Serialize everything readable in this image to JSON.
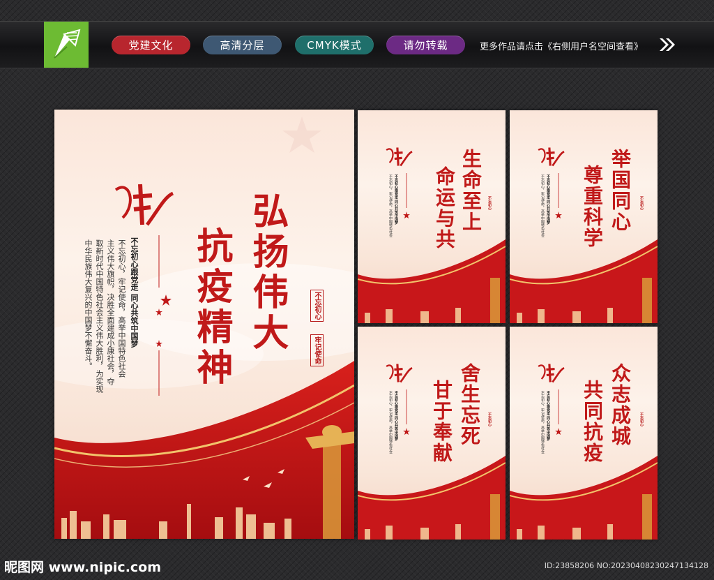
{
  "header": {
    "tags": [
      {
        "label": "党建文化",
        "color": "#b8262e"
      },
      {
        "label": "高清分层",
        "color": "#3e5873"
      },
      {
        "label": "CMYK模式",
        "color": "#1f6f6b"
      },
      {
        "label": "请勿转载",
        "color": "#6c2a84"
      }
    ],
    "more_text": "更多作品请点击《右侧用户名空间查看》",
    "logo_color": "#6dbb33"
  },
  "main_poster": {
    "title_col1": "弘扬伟大",
    "title_col2": "抗疫精神",
    "headline": "不忘初心跟党走 同心共筑中国梦",
    "body_cols": [
      "不忘初心，牢记使命，高举中国特色社会",
      "主义伟大旗帜，决胜全面建成小康社会，夺",
      "取新时代中国特色社会主义伟大胜利，为实现",
      "中华民族伟大复兴的中国梦不懈奋斗。"
    ],
    "seal_1": "不忘初心",
    "seal_2": "牢记使命"
  },
  "small_posters": [
    {
      "title_col1": "生命至上",
      "title_col2": "命运与共"
    },
    {
      "title_col1": "举国同心",
      "title_col2": "尊重科学"
    },
    {
      "title_col1": "舍生忘死",
      "title_col2": "甘于奉献"
    },
    {
      "title_col1": "众志成城",
      "title_col2": "共同抗疫"
    }
  ],
  "footer": {
    "site": "昵图网 www.nipic.com",
    "id_text": "ID:23858206 NO:20230408230247134128"
  },
  "colors": {
    "accent_red": "#c01919",
    "gold": "#d9a441"
  }
}
